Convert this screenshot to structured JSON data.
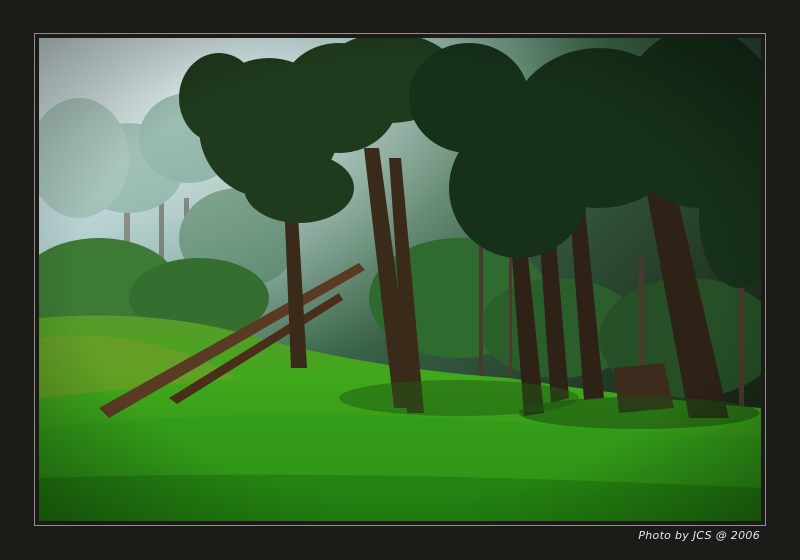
{
  "caption": "Photo by JCS @ 2006"
}
